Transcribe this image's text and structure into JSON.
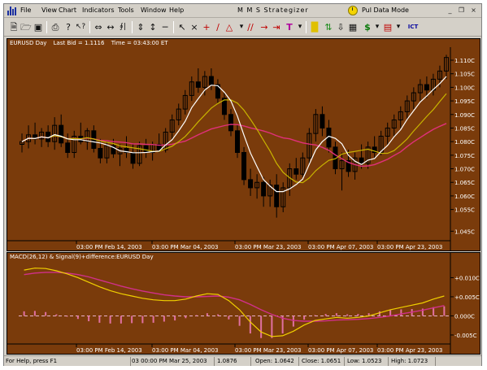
{
  "menu": {
    "items": [
      "File",
      "View",
      "Chart",
      "Indicators",
      "Tools",
      "Window",
      "Help"
    ],
    "window_title": "M M S  Strategizer",
    "mode_label": "Pul Data Mode",
    "win_buttons": [
      "_",
      "❐",
      "×"
    ]
  },
  "toolbar": {
    "icons": [
      "new-file-icon",
      "open-folder-icon",
      "save-icon",
      "print-icon",
      "help-icon",
      "whats-this-icon",
      "scroll-left-icon",
      "scroll-both-icon",
      "bars-icon",
      "scroll-vert-icon",
      "scroll-vert-both-icon",
      "horizontal-line-icon",
      "pointer-icon",
      "crosshair-icon",
      "plus-icon",
      "trendline-icon",
      "shapes-icon",
      "channel-icon",
      "ray-icon",
      "arrow-right-icon",
      "text-icon",
      "highlighter-icon",
      "bull-bear-icon",
      "arrow-down-icon",
      "grid-icon",
      "dollar-icon",
      "chart-settings-icon",
      "ict-icon"
    ],
    "text_label": "T",
    "ict_label": "ICT"
  },
  "price_pane": {
    "symbol": "EURUSD Day",
    "last_bid": "Last Bid = 1.1116",
    "time": "Time = 03:43:00 ET",
    "x_ticks": [
      "03:00 PM Feb 14, 2003",
      "03:00 PM Mar 04, 2003",
      "03:00 PM Mar 23, 2003",
      "03:00 PM Apr 07, 2003",
      "03:00 PM Apr 23, 2003"
    ],
    "y_ticks": [
      "1.110C",
      "1.105C",
      "1.100C",
      "1.095C",
      "1.090C",
      "1.085C",
      "1.080C",
      "1.075C",
      "1.070C",
      "1.065C",
      "1.060C",
      "1.055C",
      "1.045C"
    ]
  },
  "macd_pane": {
    "title": "MACD(26,12) & Signal(9)+difference:EURUSD Day",
    "x_ticks": [
      "03:00 PM Feb 14, 2003",
      "03:00 PM Mar 04, 2003",
      "03:00 PM Mar 23, 2003",
      "03:00 PM Apr 07, 2003",
      "03:00 PM Apr 23, 2003"
    ],
    "y_ticks": [
      "+0.010C",
      "+0.005C",
      "0.000C",
      "-0.005C"
    ]
  },
  "colors": {
    "pane_bg": "#7a3b0b",
    "candle": "#000000",
    "ma_fast": "#ffffff",
    "ma_mid": "#c8b400",
    "ma_slow": "#e0307a",
    "macd": "#f0d000",
    "signal": "#d0308a",
    "histogram": "#e070a0"
  },
  "chart_data": [
    {
      "type": "candlestick",
      "title": "EURUSD Day",
      "y_range": [
        1.045,
        1.113
      ],
      "candles": [
        {
          "o": 1.079,
          "h": 1.083,
          "l": 1.076,
          "c": 1.08
        },
        {
          "o": 1.08,
          "h": 1.086,
          "l": 1.0775,
          "c": 1.0825
        },
        {
          "o": 1.0825,
          "h": 1.087,
          "l": 1.079,
          "c": 1.081
        },
        {
          "o": 1.081,
          "h": 1.085,
          "l": 1.078,
          "c": 1.0835
        },
        {
          "o": 1.0835,
          "h": 1.086,
          "l": 1.078,
          "c": 1.08
        },
        {
          "o": 1.08,
          "h": 1.089,
          "l": 1.077,
          "c": 1.086
        },
        {
          "o": 1.086,
          "h": 1.09,
          "l": 1.078,
          "c": 1.0795
        },
        {
          "o": 1.0795,
          "h": 1.083,
          "l": 1.074,
          "c": 1.076
        },
        {
          "o": 1.076,
          "h": 1.084,
          "l": 1.074,
          "c": 1.082
        },
        {
          "o": 1.082,
          "h": 1.087,
          "l": 1.079,
          "c": 1.08
        },
        {
          "o": 1.08,
          "h": 1.085,
          "l": 1.077,
          "c": 1.084
        },
        {
          "o": 1.084,
          "h": 1.086,
          "l": 1.076,
          "c": 1.0775
        },
        {
          "o": 1.0775,
          "h": 1.081,
          "l": 1.072,
          "c": 1.074
        },
        {
          "o": 1.074,
          "h": 1.08,
          "l": 1.072,
          "c": 1.0785
        },
        {
          "o": 1.0785,
          "h": 1.081,
          "l": 1.074,
          "c": 1.0755
        },
        {
          "o": 1.0755,
          "h": 1.079,
          "l": 1.071,
          "c": 1.0775
        },
        {
          "o": 1.0775,
          "h": 1.082,
          "l": 1.074,
          "c": 1.076
        },
        {
          "o": 1.076,
          "h": 1.079,
          "l": 1.07,
          "c": 1.072
        },
        {
          "o": 1.072,
          "h": 1.08,
          "l": 1.071,
          "c": 1.0785
        },
        {
          "o": 1.0785,
          "h": 1.081,
          "l": 1.074,
          "c": 1.076
        },
        {
          "o": 1.076,
          "h": 1.08,
          "l": 1.073,
          "c": 1.079
        },
        {
          "o": 1.079,
          "h": 1.083,
          "l": 1.076,
          "c": 1.077
        },
        {
          "o": 1.077,
          "h": 1.085,
          "l": 1.076,
          "c": 1.0835
        },
        {
          "o": 1.0835,
          "h": 1.09,
          "l": 1.081,
          "c": 1.088
        },
        {
          "o": 1.088,
          "h": 1.094,
          "l": 1.086,
          "c": 1.092
        },
        {
          "o": 1.092,
          "h": 1.099,
          "l": 1.09,
          "c": 1.097
        },
        {
          "o": 1.097,
          "h": 1.104,
          "l": 1.095,
          "c": 1.102
        },
        {
          "o": 1.102,
          "h": 1.107,
          "l": 1.098,
          "c": 1.1
        },
        {
          "o": 1.1,
          "h": 1.106,
          "l": 1.097,
          "c": 1.104
        },
        {
          "o": 1.104,
          "h": 1.107,
          "l": 1.099,
          "c": 1.101
        },
        {
          "o": 1.101,
          "h": 1.103,
          "l": 1.094,
          "c": 1.096
        },
        {
          "o": 1.096,
          "h": 1.098,
          "l": 1.088,
          "c": 1.09
        },
        {
          "o": 1.09,
          "h": 1.092,
          "l": 1.082,
          "c": 1.084
        },
        {
          "o": 1.084,
          "h": 1.086,
          "l": 1.074,
          "c": 1.076
        },
        {
          "o": 1.076,
          "h": 1.078,
          "l": 1.064,
          "c": 1.066
        },
        {
          "o": 1.066,
          "h": 1.07,
          "l": 1.06,
          "c": 1.063
        },
        {
          "o": 1.063,
          "h": 1.068,
          "l": 1.059,
          "c": 1.065
        },
        {
          "o": 1.065,
          "h": 1.067,
          "l": 1.056,
          "c": 1.06
        },
        {
          "o": 1.06,
          "h": 1.066,
          "l": 1.056,
          "c": 1.064
        },
        {
          "o": 1.064,
          "h": 1.068,
          "l": 1.052,
          "c": 1.056
        },
        {
          "o": 1.056,
          "h": 1.065,
          "l": 1.054,
          "c": 1.063
        },
        {
          "o": 1.063,
          "h": 1.072,
          "l": 1.06,
          "c": 1.07
        },
        {
          "o": 1.07,
          "h": 1.074,
          "l": 1.066,
          "c": 1.068
        },
        {
          "o": 1.068,
          "h": 1.076,
          "l": 1.067,
          "c": 1.074
        },
        {
          "o": 1.074,
          "h": 1.085,
          "l": 1.072,
          "c": 1.083
        },
        {
          "o": 1.083,
          "h": 1.092,
          "l": 1.08,
          "c": 1.09
        },
        {
          "o": 1.09,
          "h": 1.093,
          "l": 1.082,
          "c": 1.085
        },
        {
          "o": 1.085,
          "h": 1.088,
          "l": 1.076,
          "c": 1.078
        },
        {
          "o": 1.078,
          "h": 1.08,
          "l": 1.068,
          "c": 1.07
        },
        {
          "o": 1.07,
          "h": 1.076,
          "l": 1.062,
          "c": 1.073
        },
        {
          "o": 1.073,
          "h": 1.077,
          "l": 1.067,
          "c": 1.069
        },
        {
          "o": 1.069,
          "h": 1.076,
          "l": 1.066,
          "c": 1.074
        },
        {
          "o": 1.074,
          "h": 1.079,
          "l": 1.07,
          "c": 1.072
        },
        {
          "o": 1.072,
          "h": 1.08,
          "l": 1.07,
          "c": 1.078
        },
        {
          "o": 1.078,
          "h": 1.082,
          "l": 1.074,
          "c": 1.076
        },
        {
          "o": 1.076,
          "h": 1.084,
          "l": 1.075,
          "c": 1.082
        },
        {
          "o": 1.082,
          "h": 1.087,
          "l": 1.079,
          "c": 1.085
        },
        {
          "o": 1.085,
          "h": 1.09,
          "l": 1.082,
          "c": 1.088
        },
        {
          "o": 1.088,
          "h": 1.093,
          "l": 1.085,
          "c": 1.091
        },
        {
          "o": 1.091,
          "h": 1.097,
          "l": 1.088,
          "c": 1.095
        },
        {
          "o": 1.095,
          "h": 1.1,
          "l": 1.092,
          "c": 1.098
        },
        {
          "o": 1.098,
          "h": 1.103,
          "l": 1.095,
          "c": 1.101
        },
        {
          "o": 1.101,
          "h": 1.104,
          "l": 1.096,
          "c": 1.099
        },
        {
          "o": 1.099,
          "h": 1.105,
          "l": 1.097,
          "c": 1.103
        },
        {
          "o": 1.103,
          "h": 1.108,
          "l": 1.1,
          "c": 1.106
        },
        {
          "o": 1.106,
          "h": 1.112,
          "l": 1.103,
          "c": 1.111
        }
      ]
    },
    {
      "type": "line",
      "title": "MACD(26,12) & Signal(9)+difference:EURUSD Day",
      "y_range": [
        -0.0065,
        0.0135
      ],
      "series": [
        {
          "values": [
            0.012,
            0.0125,
            0.0124,
            0.0118,
            0.011,
            0.01,
            0.0088,
            0.0076,
            0.0066,
            0.0058,
            0.0052,
            0.0046,
            0.0042,
            0.004,
            0.004,
            0.0044,
            0.0052,
            0.0058,
            0.0056,
            0.004,
            0.0016,
            -0.0016,
            -0.0042,
            -0.0054,
            -0.0052,
            -0.004,
            -0.0024,
            -0.0012,
            -0.0008,
            -0.0004,
            -0.0006,
            -0.0004,
            0.0,
            0.0008,
            0.0016,
            0.0022,
            0.0028,
            0.0034,
            0.0044,
            0.0052
          ]
        },
        {
          "values": [
            0.0108,
            0.0112,
            0.0114,
            0.0114,
            0.0112,
            0.0108,
            0.0102,
            0.0094,
            0.0086,
            0.0078,
            0.0071,
            0.0065,
            0.006,
            0.0055,
            0.0052,
            0.005,
            0.005,
            0.0051,
            0.0052,
            0.0049,
            0.0042,
            0.003,
            0.0016,
            0.0004,
            -0.0006,
            -0.0012,
            -0.0014,
            -0.0014,
            -0.0013,
            -0.0011,
            -0.001,
            -0.0009,
            -0.0007,
            -0.0004,
            0.0,
            0.0005,
            0.001,
            0.0015,
            0.0021,
            0.0027
          ]
        },
        {
          "values": [
            0.0012,
            0.0013,
            0.001,
            0.0004,
            -0.0002,
            -0.0008,
            -0.0014,
            -0.0018,
            -0.002,
            -0.002,
            -0.0019,
            -0.0019,
            -0.0018,
            -0.0015,
            -0.0012,
            -0.0006,
            0.0002,
            0.0007,
            0.0004,
            -0.0009,
            -0.0026,
            -0.0046,
            -0.0058,
            -0.0058,
            -0.0046,
            -0.0028,
            -0.001,
            0.0002,
            0.0005,
            0.0007,
            0.0004,
            0.0005,
            0.0007,
            0.0012,
            0.0016,
            0.0017,
            0.0018,
            0.0019,
            0.0023,
            0.0025
          ]
        }
      ]
    }
  ]
}
